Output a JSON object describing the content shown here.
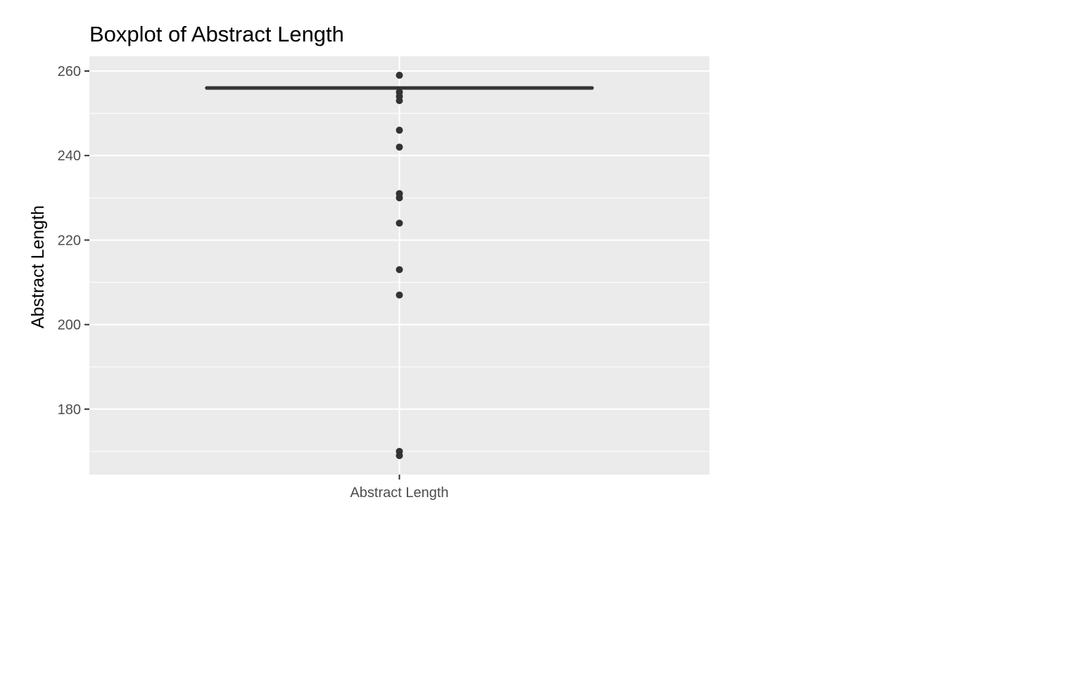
{
  "chart_data": {
    "type": "boxplot",
    "title": "Boxplot of Abstract Length",
    "xlabel": "",
    "ylabel": "Abstract Length",
    "categories": [
      "Abstract Length"
    ],
    "ylim": [
      164.5,
      263.5
    ],
    "yticks": [
      180,
      200,
      220,
      240,
      260
    ],
    "grid": true,
    "box": {
      "q1": 256,
      "median": 256,
      "q3": 256,
      "whisker_low": 256,
      "whisker_high": 256
    },
    "outliers": [
      259,
      255,
      254,
      253,
      246,
      242,
      231,
      230,
      224,
      213,
      207,
      170,
      169
    ],
    "colors": {
      "panel": "#ebebeb",
      "grid": "#ffffff",
      "points": "#333333",
      "box": "#333333"
    }
  }
}
